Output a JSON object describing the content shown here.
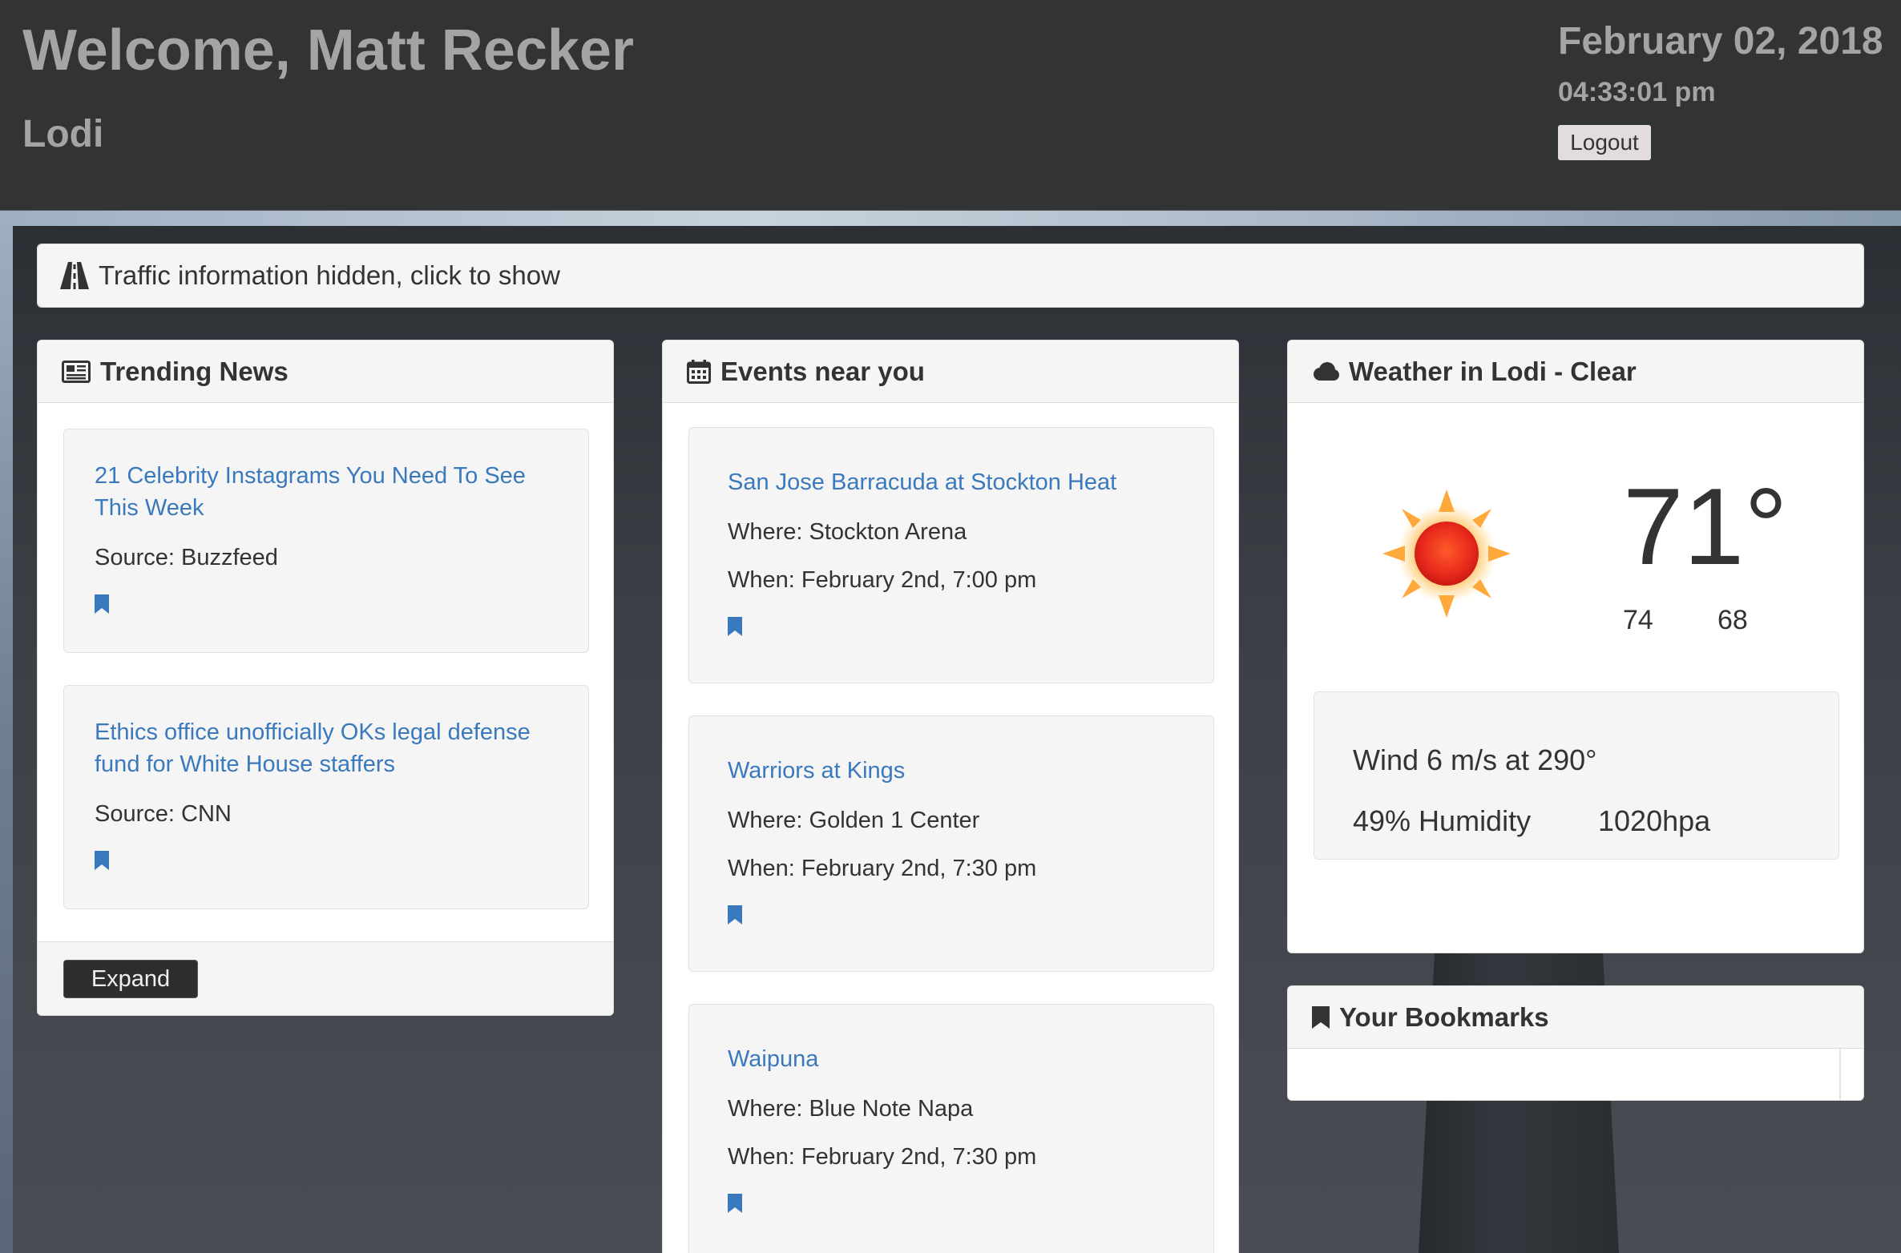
{
  "header": {
    "welcome": "Welcome, Matt Recker",
    "city": "Lodi",
    "date": "February 02, 2018",
    "time": "04:33:01 pm",
    "logout_label": "Logout"
  },
  "traffic": {
    "label": "Traffic information hidden, click to show"
  },
  "news": {
    "title": "Trending News",
    "items": [
      {
        "headline": "21 Celebrity Instagrams You Need To See This Week",
        "source": "Source: Buzzfeed"
      },
      {
        "headline": "Ethics office unofficially OKs legal defense fund for White House staffers",
        "source": "Source: CNN"
      }
    ],
    "expand_label": "Expand"
  },
  "events": {
    "title": "Events near you",
    "items": [
      {
        "name": "San Jose Barracuda at Stockton Heat",
        "where": "Where: Stockton Arena",
        "when": "When: February 2nd, 7:00 pm"
      },
      {
        "name": "Warriors at Kings",
        "where": "Where: Golden 1 Center",
        "when": "When: February 2nd, 7:30 pm"
      },
      {
        "name": "Waipuna",
        "where": "Where: Blue Note Napa",
        "when": "When: February 2nd, 7:30 pm"
      }
    ]
  },
  "weather": {
    "title": "Weather in Lodi - Clear",
    "temp": "71°",
    "high": "74",
    "low": "68",
    "wind": "Wind 6 m/s at 290°",
    "humidity": "49% Humidity",
    "pressure": "1020hpa",
    "icon": "sun-icon"
  },
  "bookmarks": {
    "title": "Your Bookmarks"
  },
  "colors": {
    "header_bg": "#323335",
    "link": "#3a79bd",
    "panel_bg": "#ffffff",
    "card_bg": "#f5f5f5",
    "muted_text": "#a4a4a4"
  }
}
